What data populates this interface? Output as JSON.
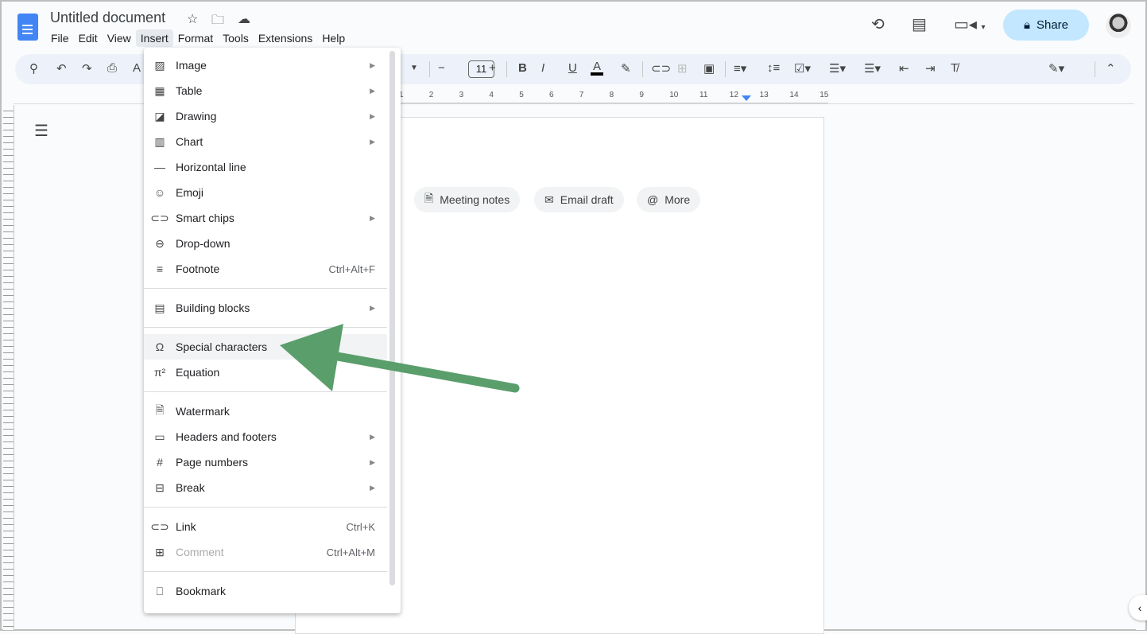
{
  "app": {
    "title": "Untitled document",
    "menus": [
      "File",
      "Edit",
      "View",
      "Insert",
      "Format",
      "Tools",
      "Extensions",
      "Help"
    ],
    "active_menu": "Insert",
    "share_label": "Share",
    "accent": "#c2e7ff"
  },
  "toolbar": {
    "font_size": "11"
  },
  "ruler": {
    "ticks": [
      "1",
      "2",
      "3",
      "4",
      "5",
      "6",
      "7",
      "8",
      "9",
      "10",
      "11",
      "12",
      "13",
      "14",
      "15"
    ]
  },
  "chips": [
    {
      "label": "Meeting notes",
      "icon": "document-icon"
    },
    {
      "label": "Email draft",
      "icon": "email-icon"
    },
    {
      "label": "More",
      "icon": "at-icon"
    }
  ],
  "insert_menu": [
    {
      "label": "Image",
      "icon": "image-icon",
      "submenu": true
    },
    {
      "label": "Table",
      "icon": "table-icon",
      "submenu": true
    },
    {
      "label": "Drawing",
      "icon": "drawing-icon",
      "submenu": true
    },
    {
      "label": "Chart",
      "icon": "chart-icon",
      "submenu": true
    },
    {
      "label": "Horizontal line",
      "icon": "horizontal-line-icon"
    },
    {
      "label": "Emoji",
      "icon": "emoji-icon"
    },
    {
      "label": "Smart chips",
      "icon": "smart-chips-icon",
      "submenu": true
    },
    {
      "label": "Drop-down",
      "icon": "dropdown-icon"
    },
    {
      "label": "Footnote",
      "icon": "footnote-icon",
      "shortcut": "Ctrl+Alt+F"
    },
    {
      "sep": true
    },
    {
      "label": "Building blocks",
      "icon": "building-blocks-icon",
      "submenu": true
    },
    {
      "sep": true
    },
    {
      "label": "Special characters",
      "icon": "omega-icon",
      "highlighted": true
    },
    {
      "label": "Equation",
      "icon": "pi-icon"
    },
    {
      "sep": true
    },
    {
      "label": "Watermark",
      "icon": "watermark-icon"
    },
    {
      "label": "Headers and footers",
      "icon": "headers-footers-icon",
      "submenu": true
    },
    {
      "label": "Page numbers",
      "icon": "hash-icon",
      "submenu": true
    },
    {
      "label": "Break",
      "icon": "break-icon",
      "submenu": true
    },
    {
      "sep": true
    },
    {
      "label": "Link",
      "icon": "link-icon",
      "shortcut": "Ctrl+K"
    },
    {
      "label": "Comment",
      "icon": "comment-icon",
      "shortcut": "Ctrl+Alt+M",
      "disabled": true
    },
    {
      "sep": true
    },
    {
      "label": "Bookmark",
      "icon": "bookmark-icon"
    }
  ],
  "annotation": {
    "color": "#5a9e6b"
  }
}
